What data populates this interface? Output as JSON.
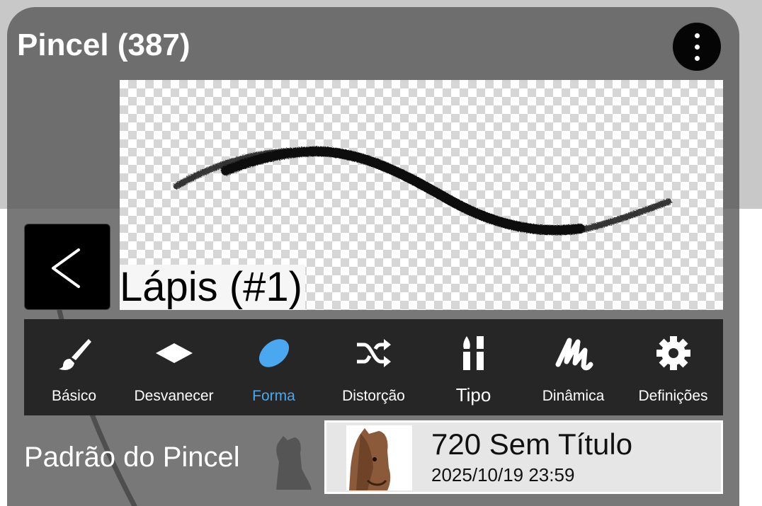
{
  "panel": {
    "title": "Pincel (387)",
    "more_icon": "more-vertical-icon"
  },
  "preview": {
    "brush_name": "Lápis (#1)"
  },
  "back_icon": "chevron-left-icon",
  "tabs": [
    {
      "label": "Básico",
      "icon": "brush-icon",
      "active": false
    },
    {
      "label": "Desvanecer",
      "icon": "diamond-icon",
      "active": false
    },
    {
      "label": "Forma",
      "icon": "ellipse-icon",
      "active": true
    },
    {
      "label": "Distorção",
      "icon": "shuffle-icon",
      "active": false
    },
    {
      "label": "Tipo",
      "icon": "brush-tips-icon",
      "active": false
    },
    {
      "label": "Dinâmica",
      "icon": "scribble-icon",
      "active": false
    },
    {
      "label": "Definições",
      "icon": "gear-icon",
      "active": false
    }
  ],
  "pattern": {
    "label": "Padrão do Pincel"
  },
  "file": {
    "name": "720 Sem Título",
    "date": "2025/10/19 23:59"
  },
  "colors": {
    "active_tab": "#4aa8f0",
    "tabbar_bg": "#262626",
    "panel_bg": "#5a5a5a"
  }
}
